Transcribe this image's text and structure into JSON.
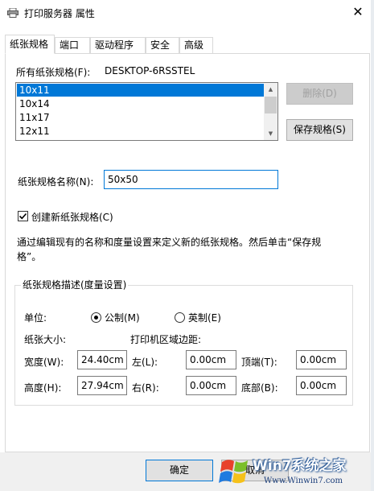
{
  "window": {
    "title": "打印服务器 属性",
    "close_glyph": "✕",
    "icon": "printer-icon"
  },
  "tabs": [
    "纸张规格",
    "端口",
    "驱动程序",
    "安全",
    "高级"
  ],
  "forms": {
    "all_forms_label": "所有纸张规格(F):",
    "server_name": "DESKTOP-6RSSTEL",
    "list": [
      "10x11",
      "10x14",
      "11x17",
      "12x11"
    ],
    "selected": "10x11",
    "delete_label": "删除(D)",
    "save_label": "保存规格(S)",
    "name_label": "纸张规格名称(N):",
    "name_value": "50x50",
    "create_new_label": "创建新纸张规格(C)",
    "create_new_checked": true,
    "instruction": "通过编辑现有的名称和度量设置来定义新的纸张规格。然后单击“保存规格”。"
  },
  "measurements": {
    "group_title": "纸张规格描述(度量设置)",
    "units_label": "单位:",
    "metric_label": "公制(M)",
    "english_label": "英制(E)",
    "selected_unit": "metric",
    "paper_size_label": "纸张大小:",
    "margins_label": "打印机区域边距:",
    "width_label": "宽度(W):",
    "width_value": "24.40cm",
    "height_label": "高度(H):",
    "height_value": "27.94cm",
    "left_label": "左(L):",
    "left_value": "0.00cm",
    "right_label": "右(R):",
    "right_value": "0.00cm",
    "top_label": "顶端(T):",
    "top_value": "0.00cm",
    "bottom_label": "底部(B):",
    "bottom_value": "0.00cm"
  },
  "footer": {
    "ok_label": "确定",
    "cancel_label": "取消"
  },
  "watermark": {
    "text": "Win7系统之家",
    "url": "Www.Winwin7.com"
  },
  "colors": {
    "selection": "#0078d7",
    "footer_bg": "#f0f0f0"
  }
}
